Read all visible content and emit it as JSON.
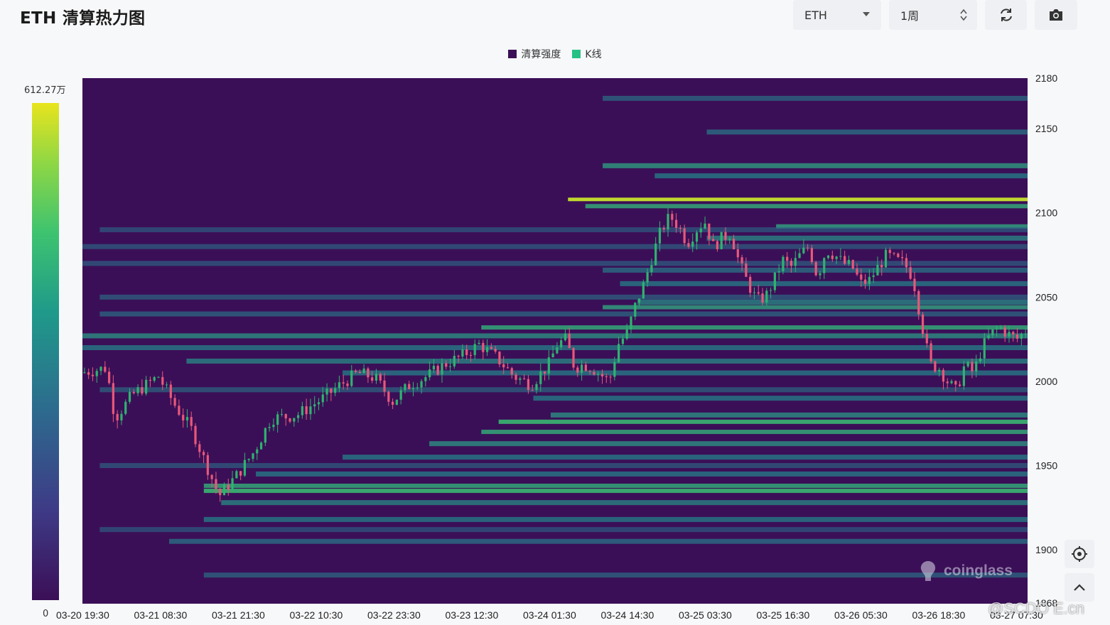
{
  "header": {
    "title": "ETH 清算热力图",
    "symbol_select": "ETH",
    "period_select": "1周",
    "refresh_icon": "refresh-icon",
    "screenshot_icon": "camera-icon"
  },
  "colors": {
    "background": "#3b0f57",
    "candle_up": "#2fb36f",
    "candle_down": "#e8587a",
    "legend_heat": "#3b0f57",
    "legend_kline": "#27c184",
    "band_low": "#37407f",
    "band_mid": "#24878c",
    "band_high": "#3cc36e",
    "band_peak": "#e6e41d"
  },
  "colorbar": {
    "max_label": "612.27万",
    "min_label": "0"
  },
  "side_buttons": [
    "settings-icon",
    "chevron-up-icon"
  ],
  "watermark": "coinglass",
  "credit": "@SCDO E.cn",
  "chart_data": {
    "type": "heatmap",
    "title": "",
    "legend": [
      "清算强度",
      "K线"
    ],
    "legend_position": "top-center",
    "x_tick_labels": [
      "03-20 19:30",
      "03-21 08:30",
      "03-21 21:30",
      "03-22 10:30",
      "03-22 23:30",
      "03-23 12:30",
      "03-24 01:30",
      "03-24 14:30",
      "03-25 03:30",
      "03-25 16:30",
      "03-26 05:30",
      "03-26 18:30",
      "03-27 07:30"
    ],
    "y_ticks": [
      2150,
      2100,
      2050,
      2000,
      1950,
      1900
    ],
    "y_top_label": "2180",
    "y_bottom_label": "1868",
    "ylim": [
      1868,
      2180
    ],
    "y_position": "right",
    "intensity_range": [
      0,
      6122700
    ],
    "price_path": [
      [
        0,
        2005
      ],
      [
        3,
        2008
      ],
      [
        4,
        1978
      ],
      [
        6,
        1992
      ],
      [
        9,
        2003
      ],
      [
        11,
        1985
      ],
      [
        13,
        1970
      ],
      [
        14,
        1957
      ],
      [
        16,
        1932
      ],
      [
        18,
        1944
      ],
      [
        20,
        1958
      ],
      [
        22,
        1978
      ],
      [
        25,
        1980
      ],
      [
        28,
        1990
      ],
      [
        30,
        1998
      ],
      [
        32,
        2005
      ],
      [
        34,
        2002
      ],
      [
        36,
        1988
      ],
      [
        38,
        1998
      ],
      [
        40,
        2003
      ],
      [
        42,
        2010
      ],
      [
        44,
        2015
      ],
      [
        46,
        2022
      ],
      [
        48,
        2014
      ],
      [
        50,
        2003
      ],
      [
        52,
        1998
      ],
      [
        54,
        2010
      ],
      [
        55,
        2022
      ],
      [
        56,
        2025
      ],
      [
        57,
        2008
      ],
      [
        58,
        2010
      ],
      [
        59,
        2008
      ],
      [
        60,
        2004
      ],
      [
        61,
        2000
      ],
      [
        62,
        2022
      ],
      [
        63,
        2028
      ],
      [
        64,
        2045
      ],
      [
        65,
        2058
      ],
      [
        66,
        2075
      ],
      [
        67,
        2090
      ],
      [
        68,
        2098
      ],
      [
        69,
        2092
      ],
      [
        70,
        2082
      ],
      [
        71,
        2090
      ],
      [
        72,
        2095
      ],
      [
        73,
        2080
      ],
      [
        74,
        2085
      ],
      [
        75,
        2088
      ],
      [
        76,
        2070
      ],
      [
        77,
        2058
      ],
      [
        78,
        2048
      ],
      [
        79,
        2050
      ],
      [
        80,
        2060
      ],
      [
        81,
        2072
      ],
      [
        82,
        2068
      ],
      [
        83,
        2075
      ],
      [
        84,
        2080
      ],
      [
        85,
        2062
      ],
      [
        86,
        2078
      ],
      [
        87,
        2075
      ],
      [
        88,
        2070
      ],
      [
        89,
        2068
      ],
      [
        90,
        2058
      ],
      [
        91,
        2060
      ],
      [
        92,
        2068
      ],
      [
        93,
        2075
      ],
      [
        94,
        2072
      ],
      [
        95,
        2070
      ],
      [
        96,
        2062
      ],
      [
        97,
        2035
      ],
      [
        98,
        2010
      ],
      [
        99,
        2008
      ],
      [
        100,
        2000
      ],
      [
        101,
        1994
      ],
      [
        102,
        2010
      ],
      [
        103,
        2005
      ],
      [
        104,
        2020
      ],
      [
        105,
        2028
      ],
      [
        106,
        2032
      ],
      [
        107,
        2028
      ],
      [
        108,
        2025
      ],
      [
        109,
        2030
      ]
    ],
    "bands": [
      {
        "price": 2108,
        "x_start": 56,
        "intensity": 0.95
      },
      {
        "price": 2104,
        "x_start": 58,
        "intensity": 0.6
      },
      {
        "price": 2092,
        "x_start": 80,
        "intensity": 0.55
      },
      {
        "price": 2085,
        "x_start": 72,
        "intensity": 0.4
      },
      {
        "price": 2128,
        "x_start": 60,
        "intensity": 0.5
      },
      {
        "price": 2122,
        "x_start": 66,
        "intensity": 0.35
      },
      {
        "price": 2168,
        "x_start": 60,
        "intensity": 0.25
      },
      {
        "price": 2148,
        "x_start": 72,
        "intensity": 0.3
      },
      {
        "price": 2066,
        "x_start": 60,
        "intensity": 0.3
      },
      {
        "price": 2058,
        "x_start": 62,
        "intensity": 0.35
      },
      {
        "price": 2047,
        "x_start": 64,
        "intensity": 0.4
      },
      {
        "price": 2044,
        "x_start": 60,
        "intensity": 0.55
      },
      {
        "price": 2032,
        "x_start": 46,
        "intensity": 0.6
      },
      {
        "price": 2027,
        "x_start": 0,
        "intensity": 0.45
      },
      {
        "price": 2020,
        "x_start": 0,
        "intensity": 0.35
      },
      {
        "price": 2012,
        "x_start": 12,
        "intensity": 0.4
      },
      {
        "price": 2005,
        "x_start": 30,
        "intensity": 0.35
      },
      {
        "price": 1990,
        "x_start": 52,
        "intensity": 0.35
      },
      {
        "price": 1980,
        "x_start": 54,
        "intensity": 0.45
      },
      {
        "price": 1976,
        "x_start": 48,
        "intensity": 0.7
      },
      {
        "price": 1970,
        "x_start": 46,
        "intensity": 0.6
      },
      {
        "price": 1963,
        "x_start": 40,
        "intensity": 0.45
      },
      {
        "price": 1955,
        "x_start": 30,
        "intensity": 0.35
      },
      {
        "price": 1945,
        "x_start": 20,
        "intensity": 0.35
      },
      {
        "price": 1938,
        "x_start": 14,
        "intensity": 0.6
      },
      {
        "price": 1935,
        "x_start": 14,
        "intensity": 0.7
      },
      {
        "price": 1928,
        "x_start": 16,
        "intensity": 0.4
      },
      {
        "price": 1918,
        "x_start": 14,
        "intensity": 0.35
      },
      {
        "price": 1905,
        "x_start": 10,
        "intensity": 0.3
      },
      {
        "price": 1885,
        "x_start": 14,
        "intensity": 0.25
      },
      {
        "price": 2080,
        "x_start": 0,
        "intensity": 0.2
      },
      {
        "price": 2070,
        "x_start": 0,
        "intensity": 0.2
      },
      {
        "price": 2090,
        "x_start": 2,
        "intensity": 0.18
      },
      {
        "price": 2050,
        "x_start": 2,
        "intensity": 0.22
      },
      {
        "price": 2040,
        "x_start": 2,
        "intensity": 0.25
      },
      {
        "price": 1995,
        "x_start": 2,
        "intensity": 0.22
      },
      {
        "price": 1950,
        "x_start": 2,
        "intensity": 0.2
      },
      {
        "price": 1912,
        "x_start": 2,
        "intensity": 0.18
      }
    ]
  }
}
